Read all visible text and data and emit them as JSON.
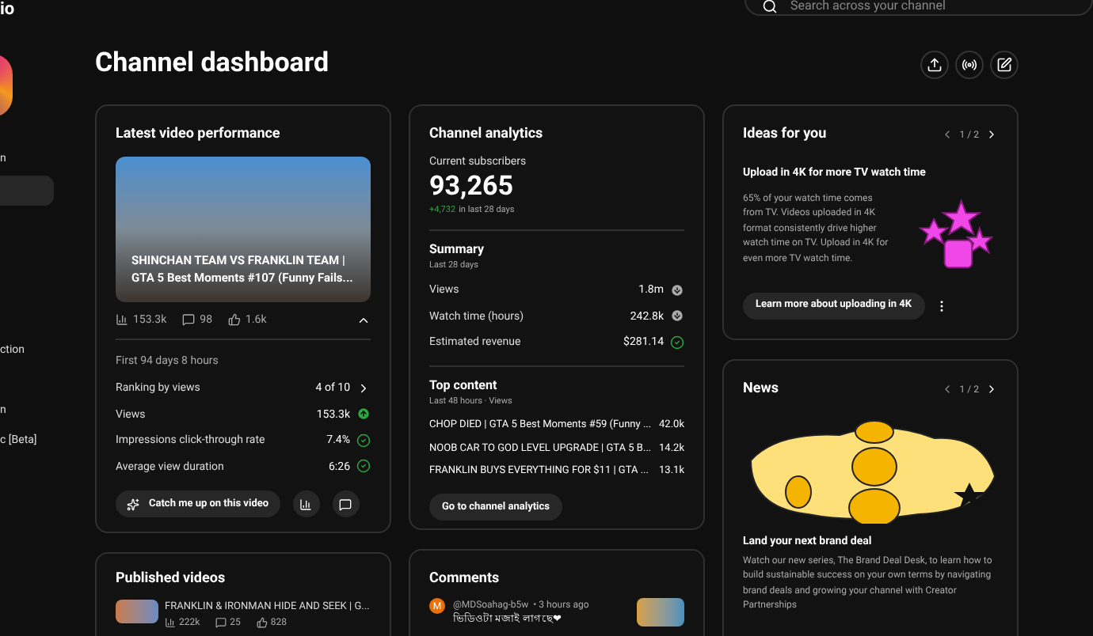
{
  "sidebar": {
    "logo_fragment": "io",
    "channel_fragment": "n",
    "items": [
      {
        "selected": true
      },
      {
        "label": "ction",
        "selected": false
      },
      {
        "label": "n",
        "selected": false
      },
      {
        "label": "c [Beta]",
        "selected": false
      }
    ]
  },
  "search": {
    "placeholder": "Search across your channel"
  },
  "page_title": "Channel dashboard",
  "latest_video": {
    "title": "Latest video performance",
    "video_title": "SHINCHAN TEAM VS FRANKLIN TEAM | GTA 5 Best Moments #107 (Funny Fails...",
    "views": "153.3k",
    "comments": "98",
    "likes": "1.6k",
    "expanded": true,
    "period": "First 94 days 8 hours",
    "metrics": [
      {
        "label": "Ranking by views",
        "value": "4 of 10",
        "kind": "link"
      },
      {
        "label": "Views",
        "value": "153.3k",
        "kind": "up"
      },
      {
        "label": "Impressions click-through rate",
        "value": "7.4%",
        "kind": "check"
      },
      {
        "label": "Average view duration",
        "value": "6:26",
        "kind": "check"
      }
    ],
    "button": "Catch me up on this video"
  },
  "analytics": {
    "title": "Channel analytics",
    "subs_label": "Current subscribers",
    "subs": "93,265",
    "delta": "+4,732",
    "delta_suffix": "in last 28 days",
    "summary_title": "Summary",
    "summary_period": "Last 28 days",
    "summary": [
      {
        "label": "Views",
        "value": "1.8m",
        "kind": "neutral"
      },
      {
        "label": "Watch time (hours)",
        "value": "242.8k",
        "kind": "neutral"
      },
      {
        "label": "Estimated revenue",
        "value": "$281.14",
        "kind": "check"
      }
    ],
    "top_title": "Top content",
    "top_period": "Last 48 hours · Views",
    "top": [
      {
        "title": "CHOP DIED | GTA 5 Best Moments #59 (Funny ...",
        "views": "42.0k"
      },
      {
        "title": "NOOB CAR TO GOD LEVEL UPGRADE | GTA 5 B...",
        "views": "14.2k"
      },
      {
        "title": "FRANKLIN BUYS EVERYTHING FOR $11 | GTA ...",
        "views": "13.1k"
      }
    ],
    "button": "Go to channel analytics"
  },
  "ideas": {
    "title": "Ideas for you",
    "pager": "1 / 2",
    "heading": "Upload in 4K for more TV watch time",
    "body": "65% of your watch time comes from TV. Videos uploaded in 4K format consistently drive higher watch time on TV. Upload in 4K for even more TV watch time.",
    "button": "Learn more about uploading in 4K"
  },
  "news": {
    "title": "News",
    "pager": "1 / 2",
    "heading": "Land your next brand deal",
    "body": "Watch our new series, The Brand Deal Desk, to learn how to build sustainable success on your own terms by navigating brand deals and growing your channel with Creator Partnerships"
  },
  "published": {
    "title": "Published videos",
    "videos": [
      {
        "title": "FRANKLIN & IRONMAN HIDE AND SEEK | G...",
        "views": "222k",
        "comments": "25",
        "likes": "828"
      }
    ]
  },
  "comments": {
    "title": "Comments",
    "items": [
      {
        "avatar": "M",
        "author": "@MDSoahag-b5w",
        "time": "• 3 hours ago",
        "text": "ভিডিওটা মজাই লাগছে❤"
      }
    ]
  }
}
